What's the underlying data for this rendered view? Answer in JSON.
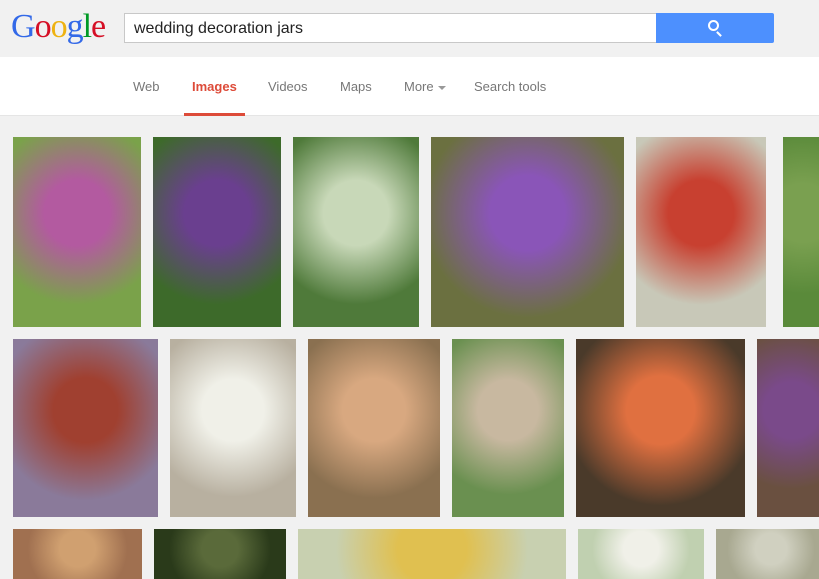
{
  "logo": {
    "text": "Google",
    "letters": [
      "G",
      "o",
      "o",
      "g",
      "l",
      "e"
    ],
    "colors": [
      "#3369e8",
      "#d50f25",
      "#eeb211",
      "#3369e8",
      "#009925",
      "#d50f25"
    ]
  },
  "search": {
    "query": "wedding decoration jars",
    "button_color": "#4d90fe"
  },
  "nav": {
    "tabs": [
      {
        "label": "Web"
      },
      {
        "label": "Images",
        "active": true
      },
      {
        "label": "Videos"
      },
      {
        "label": "Maps"
      },
      {
        "label": "More"
      },
      {
        "label": "Search tools"
      }
    ],
    "active_color": "#dd4b39"
  },
  "results": {
    "rows": [
      [
        {
          "c1": "#7aa24a",
          "c2": "#b35aa0"
        },
        {
          "c1": "#3d6a2a",
          "c2": "#6a3f8f"
        },
        {
          "c1": "#4f7a3a",
          "c2": "#c8d8b8"
        },
        {
          "c1": "#6b7040",
          "c2": "#8a55b8"
        },
        {
          "c1": "#c8c8b8",
          "c2": "#c84030"
        },
        {
          "c1": "#5a8a3a",
          "c2": "#7aa050"
        }
      ],
      [
        {
          "c1": "#8a7a9a",
          "c2": "#a04030"
        },
        {
          "c1": "#b8b0a0",
          "c2": "#f0f0e8"
        },
        {
          "c1": "#8a7050",
          "c2": "#d8a880"
        },
        {
          "c1": "#6a9050",
          "c2": "#c8b8a0"
        },
        {
          "c1": "#4a3a2a",
          "c2": "#e07040"
        },
        {
          "c1": "#6a5040",
          "c2": "#7a4a8a"
        }
      ],
      [
        {
          "c1": "#a07050",
          "c2": "#d0a070"
        },
        {
          "c1": "#2a3a1a",
          "c2": "#5a6a3a"
        },
        {
          "c1": "#c8d0b0",
          "c2": "#e0c050"
        },
        {
          "c1": "#c0d0b0",
          "c2": "#f0f0e8"
        },
        {
          "c1": "#a8a890",
          "c2": "#d0d0c0"
        }
      ]
    ]
  }
}
